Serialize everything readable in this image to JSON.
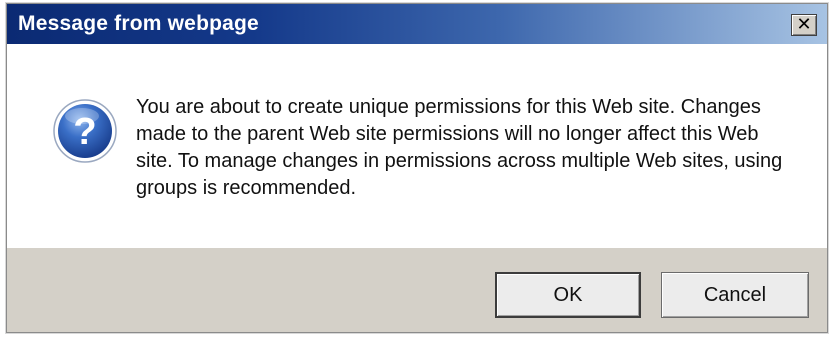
{
  "dialog": {
    "title": "Message from webpage",
    "close_label": "✕",
    "icon": "question-icon",
    "message": "You are about to create unique permissions for this Web site. Changes made to the parent Web site permissions will no longer affect this Web site. To manage changes in permissions across multiple Web sites, using groups is recommended.",
    "buttons": {
      "ok_label": "OK",
      "cancel_label": "Cancel"
    }
  },
  "colors": {
    "titlebar_start": "#0b2a73",
    "titlebar_end": "#a7c3e3",
    "footer_bg": "#d4d0c8",
    "icon_blue": "#2a5fb8"
  }
}
